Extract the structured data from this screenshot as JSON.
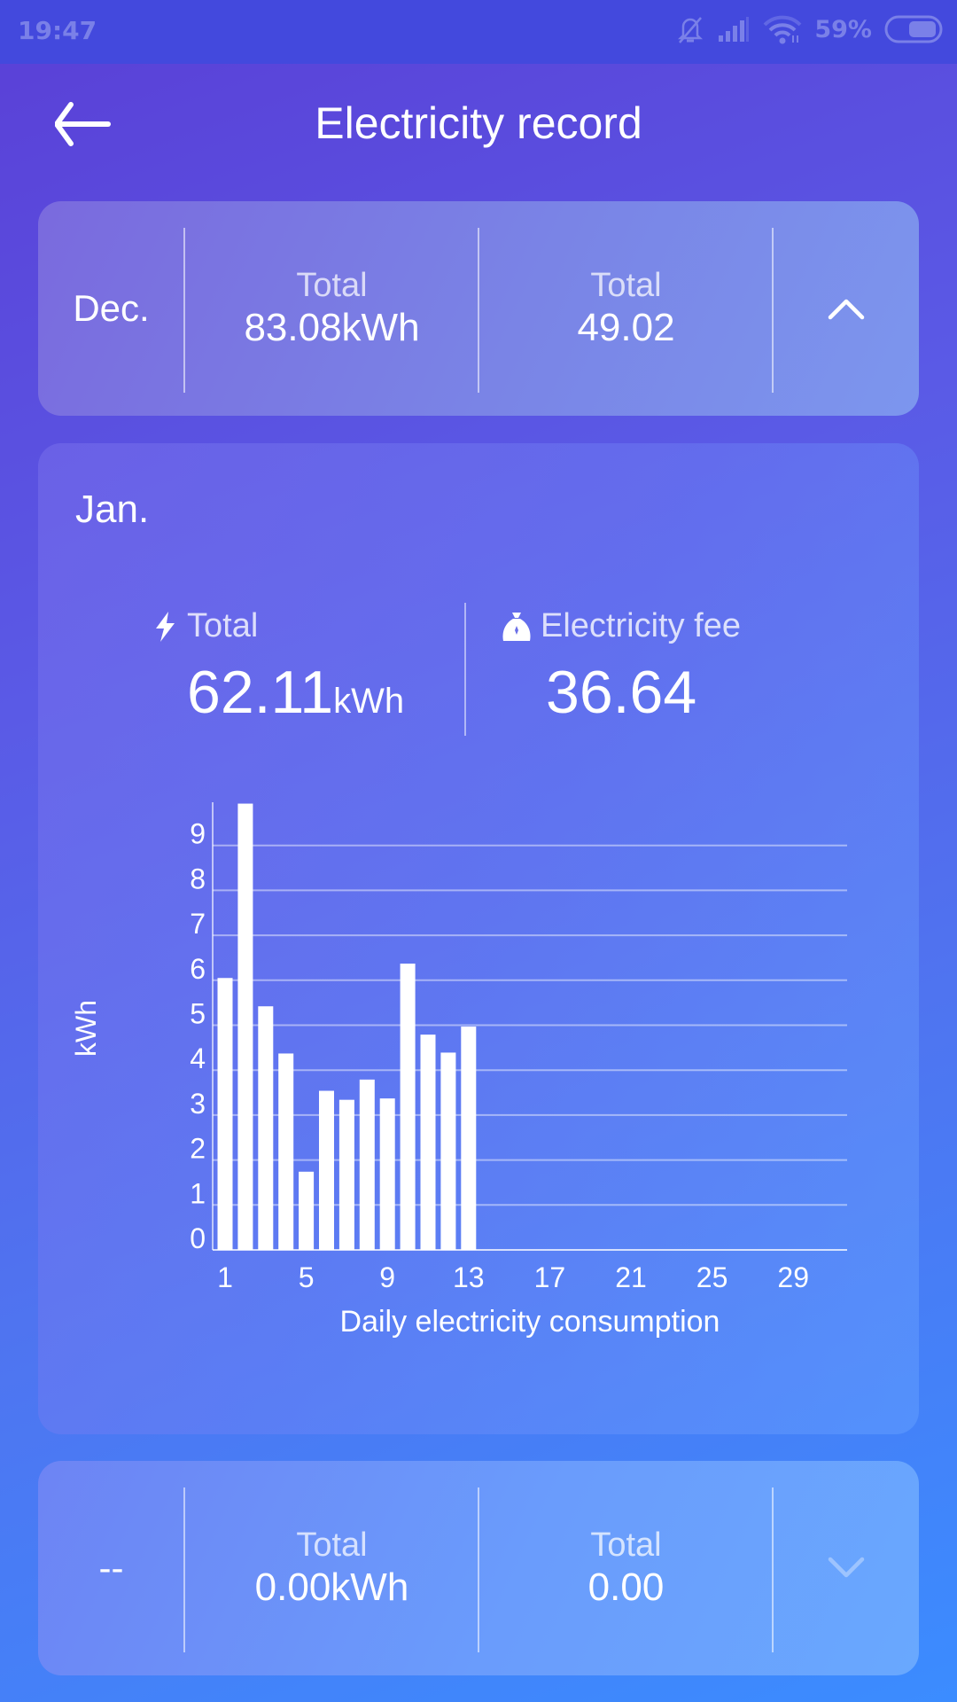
{
  "status_bar": {
    "time": "19:47",
    "battery_percent": "59%",
    "battery_level": 0.59,
    "icons": [
      "bell-off-icon",
      "signal-icon",
      "wifi-icon",
      "battery-icon"
    ]
  },
  "header": {
    "title": "Electricity record",
    "back_icon": "arrow-left-icon"
  },
  "previous_month": {
    "month": "Dec.",
    "energy_label": "Total",
    "energy_value": "83.08kWh",
    "fee_label": "Total",
    "fee_value": "49.02",
    "toggle_icon": "chevron-up-icon"
  },
  "current_month": {
    "month": "Jan.",
    "total_label": "Total",
    "total_value": "62.11",
    "total_unit": "kWh",
    "total_icon": "lightning-icon",
    "fee_label": "Electricity fee",
    "fee_value": "36.64",
    "fee_icon": "money-bag-icon"
  },
  "next_month": {
    "month": "--",
    "energy_label": "Total",
    "energy_value": "0.00kWh",
    "fee_label": "Total",
    "fee_value": "0.00",
    "toggle_icon": "chevron-down-icon"
  },
  "chart_data": {
    "type": "bar",
    "title": "",
    "xlabel": "Daily electricity consumption",
    "ylabel": "kWh",
    "ylim": [
      0,
      10
    ],
    "xlim": [
      1,
      31
    ],
    "yticks": [
      0,
      1,
      2,
      3,
      4,
      5,
      6,
      7,
      8,
      9
    ],
    "xticks": [
      1,
      5,
      9,
      13,
      17,
      21,
      25,
      29
    ],
    "grid": true,
    "x": [
      1,
      2,
      3,
      4,
      5,
      6,
      7,
      8,
      9,
      10,
      11,
      12,
      13
    ],
    "values": [
      6.05,
      9.93,
      5.42,
      4.37,
      1.74,
      3.54,
      3.34,
      3.79,
      3.37,
      6.37,
      4.79,
      4.39,
      4.97
    ],
    "bar_color": "#ffffff"
  }
}
